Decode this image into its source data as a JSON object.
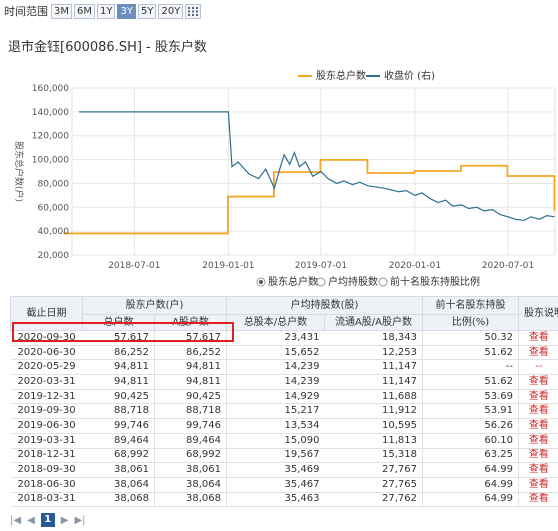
{
  "range": {
    "label": "时间范围",
    "options": [
      "3M",
      "6M",
      "1Y",
      "3Y",
      "5Y",
      "20Y"
    ],
    "active": "3Y"
  },
  "title": "退市金钰[600086.SH] - 股东户数",
  "legend": {
    "a": "股东总户数",
    "b": "收盘价 (右)"
  },
  "options": [
    "股东总户数",
    "户均持股数",
    "前十名股东持股比例"
  ],
  "colors": {
    "holders": "#f5a623",
    "price": "#2c6e8f",
    "accent": "#cc2a2a",
    "highlight": "#e02020"
  },
  "chart_data": {
    "type": "line",
    "title": "",
    "ylabel": "股东总户数(户)",
    "ylim": [
      20000,
      160000
    ],
    "yticks": [
      "20,000",
      "40,000",
      "60,000",
      "80,000",
      "100,000",
      "120,000",
      "140,000",
      "160,000"
    ],
    "xticks": [
      "2018-07-01",
      "2019-01-01",
      "2019-07-01",
      "2020-01-01",
      "2020-07-01"
    ],
    "x": [
      "2018-03-31",
      "2018-06-30",
      "2018-09-30",
      "2018-12-31",
      "2019-03-31",
      "2019-06-30",
      "2019-09-30",
      "2019-12-31",
      "2020-03-31",
      "2020-05-29",
      "2020-06-30",
      "2020-09-30"
    ],
    "series": [
      {
        "name": "股东总户数",
        "values": [
          38068,
          38064,
          38061,
          68992,
          89464,
          99746,
          88718,
          90425,
          94811,
          94811,
          86252,
          57617
        ]
      },
      {
        "name": "收盘价 (右)",
        "x": [
          "2018-03-15",
          "2018-06-01",
          "2019-01-01",
          "2019-01-08",
          "2019-01-20",
          "2019-02-10",
          "2019-03-01",
          "2019-03-15",
          "2019-04-01",
          "2019-04-10",
          "2019-04-20",
          "2019-05-01",
          "2019-05-10",
          "2019-05-20",
          "2019-06-01",
          "2019-06-15",
          "2019-07-01",
          "2019-07-15",
          "2019-08-01",
          "2019-08-15",
          "2019-09-01",
          "2019-09-15",
          "2019-10-01",
          "2019-11-01",
          "2019-12-01",
          "2019-12-15",
          "2020-01-01",
          "2020-01-15",
          "2020-02-01",
          "2020-02-15",
          "2020-03-01",
          "2020-03-15",
          "2020-04-01",
          "2020-04-15",
          "2020-05-01",
          "2020-05-15",
          "2020-06-01",
          "2020-06-15",
          "2020-07-01",
          "2020-07-15",
          "2020-08-01",
          "2020-08-15",
          "2020-09-01",
          "2020-09-15",
          "2020-09-30"
        ],
        "values": [
          140000,
          140000,
          140000,
          94000,
          98000,
          88000,
          84000,
          92000,
          76000,
          90000,
          104000,
          96000,
          106000,
          94000,
          98000,
          86000,
          90000,
          84000,
          80000,
          82000,
          79000,
          81000,
          78000,
          76000,
          73000,
          74000,
          70000,
          72000,
          67000,
          64000,
          66000,
          61000,
          62000,
          59000,
          60000,
          57000,
          58000,
          54000,
          52000,
          50000,
          49000,
          52000,
          50000,
          53000,
          52000
        ]
      }
    ]
  },
  "table": {
    "headers": {
      "date": "截止日期",
      "holders_group": "股东户数(户)",
      "total": "总户数",
      "a_holders": "A股户数",
      "avg_group": "户均持股数(股)",
      "avg_total": "总股本/总户数",
      "avg_float": "流通A股/A股户数",
      "top10_line1": "前十名股东持股",
      "top10_line2": "比例(%)",
      "notes": "股东说明"
    },
    "rows": [
      [
        "2020-09-30",
        "57,617",
        "57,617",
        "23,431",
        "18,343",
        "50.32",
        "查看"
      ],
      [
        "2020-06-30",
        "86,252",
        "86,252",
        "15,652",
        "12,253",
        "51.62",
        "查看"
      ],
      [
        "2020-05-29",
        "94,811",
        "94,811",
        "14,239",
        "11,147",
        "--",
        "--"
      ],
      [
        "2020-03-31",
        "94,811",
        "94,811",
        "14,239",
        "11,147",
        "51.62",
        "查看"
      ],
      [
        "2019-12-31",
        "90,425",
        "90,425",
        "14,929",
        "11,688",
        "53.69",
        "查看"
      ],
      [
        "2019-09-30",
        "88,718",
        "88,718",
        "15,217",
        "11,912",
        "53.91",
        "查看"
      ],
      [
        "2019-06-30",
        "99,746",
        "99,746",
        "13,534",
        "10,595",
        "56.26",
        "查看"
      ],
      [
        "2019-03-31",
        "89,464",
        "89,464",
        "15,090",
        "11,813",
        "60.10",
        "查看"
      ],
      [
        "2018-12-31",
        "68,992",
        "68,992",
        "19,567",
        "15,318",
        "63.25",
        "查看"
      ],
      [
        "2018-09-30",
        "38,061",
        "38,061",
        "35,469",
        "27,767",
        "64.99",
        "查看"
      ],
      [
        "2018-06-30",
        "38,064",
        "38,064",
        "35,467",
        "27,765",
        "64.99",
        "查看"
      ],
      [
        "2018-03-31",
        "38,068",
        "38,068",
        "35,463",
        "27,762",
        "64.99",
        "查看"
      ]
    ]
  },
  "pager": {
    "first": "|◀",
    "prev": "◀",
    "current": "1",
    "next": "▶",
    "last": "▶|"
  }
}
